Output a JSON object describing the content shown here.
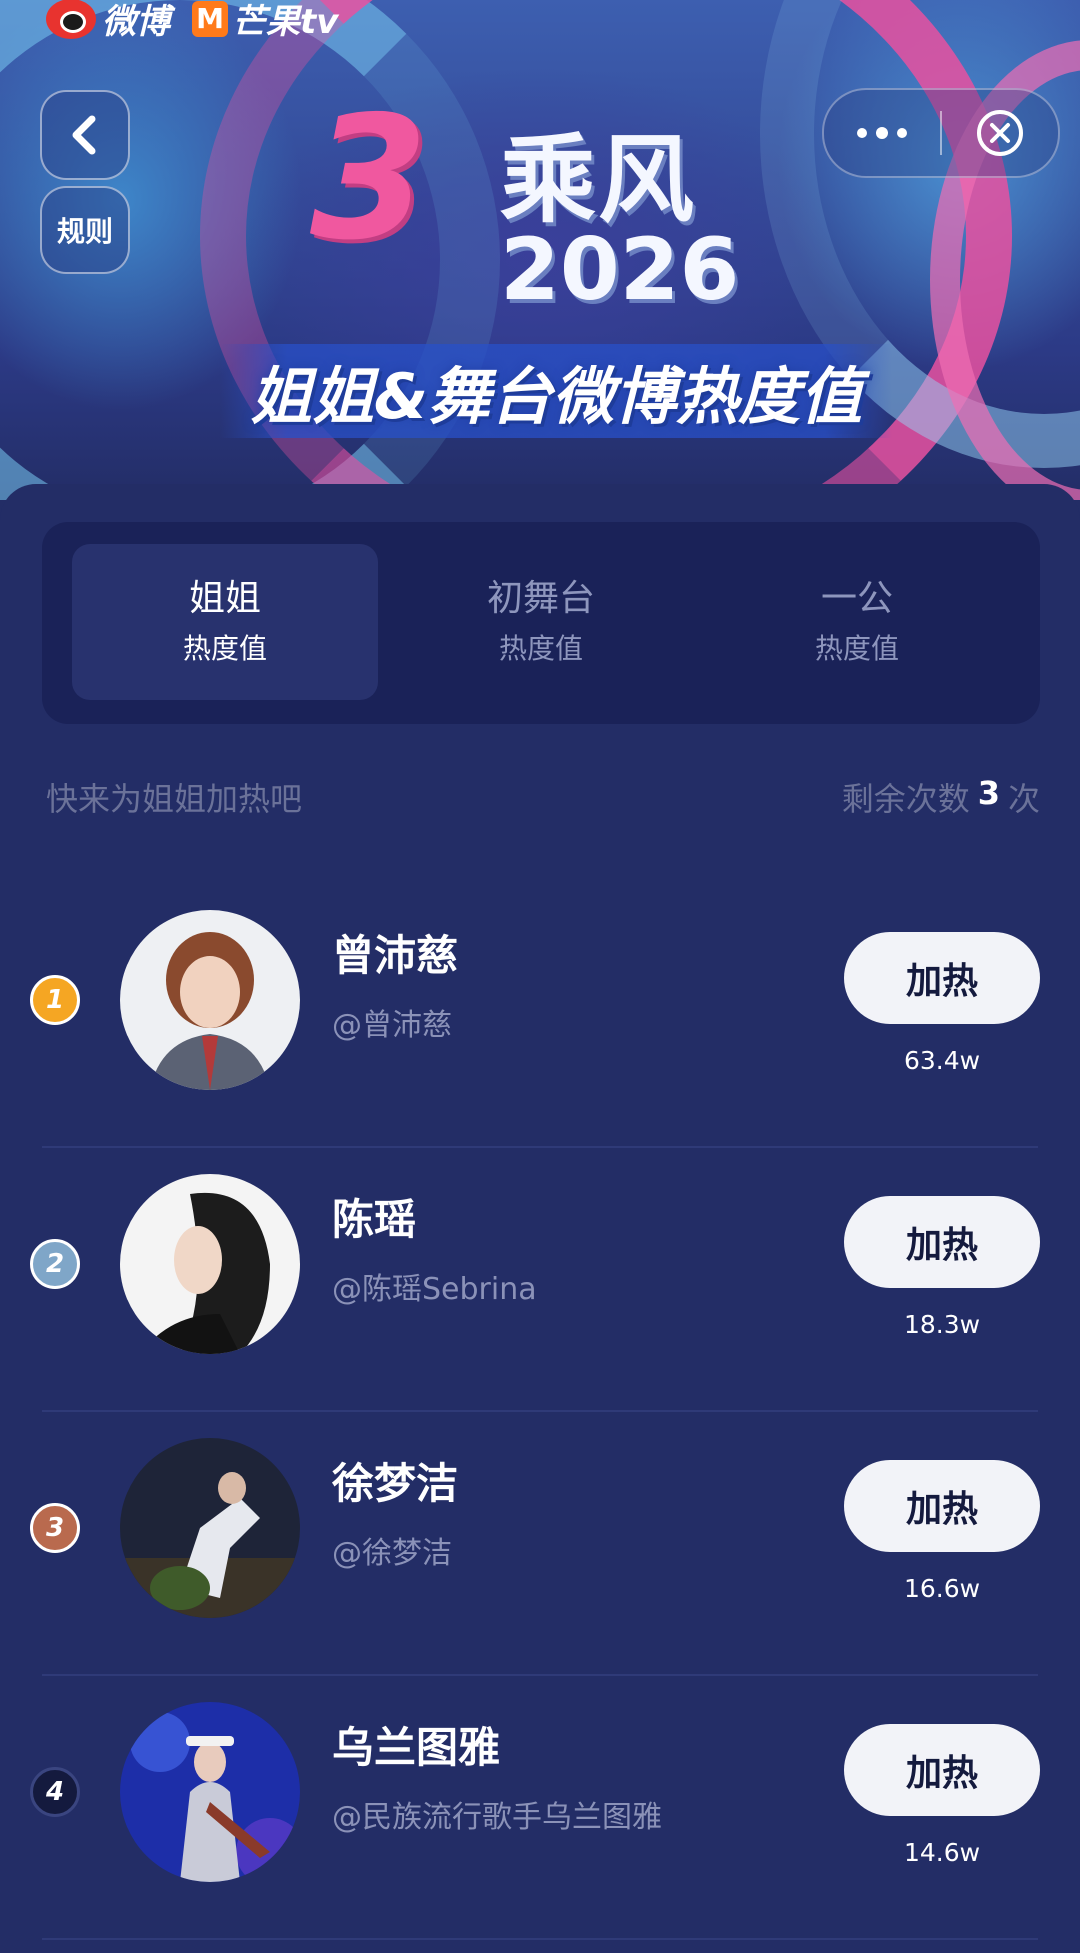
{
  "brand": {
    "weibo": "微博",
    "mango": "芒果tv"
  },
  "banner": {
    "mark": "3",
    "title": "乘风",
    "year": "2026",
    "subtitle": "姐姐&舞台微博热度值"
  },
  "nav": {
    "rules_label": "规则"
  },
  "tabs": [
    {
      "name": "姐姐",
      "sub": "热度值",
      "active": true
    },
    {
      "name": "初舞台",
      "sub": "热度值",
      "active": false
    },
    {
      "name": "一公",
      "sub": "热度值",
      "active": false
    }
  ],
  "hint": "快来为姐姐加热吧",
  "remaining": {
    "label": "剩余次数",
    "count": "3",
    "unit": "次"
  },
  "button_label": "加热",
  "ranking": [
    {
      "rank": "1",
      "name": "曾沛慈",
      "handle": "@曾沛慈",
      "value": "63.4w",
      "rank_color": "#f5a623"
    },
    {
      "rank": "2",
      "name": "陈瑶",
      "handle": "@陈瑶Sebrina",
      "value": "18.3w",
      "rank_color": "#7fa6c8"
    },
    {
      "rank": "3",
      "name": "徐梦洁",
      "handle": "@徐梦洁",
      "value": "16.6w",
      "rank_color": "#b96a4e"
    },
    {
      "rank": "4",
      "name": "乌兰图雅",
      "handle": "@民族流行歌手乌兰图雅",
      "value": "14.6w",
      "rank_color": "#141a3e"
    }
  ],
  "colors": {
    "background": "#232d66",
    "tab_bar": "#1a2258",
    "button": "#f2f3f8",
    "accent_pink": "#f0589f"
  }
}
